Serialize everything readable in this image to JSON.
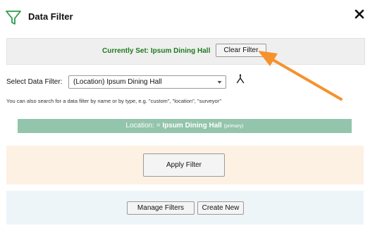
{
  "header": {
    "title": "Data Filter",
    "icon": "funnel-icon",
    "close_icon": "close-icon"
  },
  "current": {
    "label": "Currently Set: Ipsum Dining Hall",
    "clear_button": "Clear Filter"
  },
  "select": {
    "label": "Select Data Filter:",
    "value": "(Location) Ipsum Dining Hall",
    "hint": "You can also search for a data filter by name or by type, e.g. \"custom\", \"location\", \"surveyor\""
  },
  "location_bar": {
    "prefix": "Location: = ",
    "name": "Ipsum Dining Hall",
    "suffix": "(primary)"
  },
  "apply": {
    "button": "Apply Filter"
  },
  "manage": {
    "manage_button": "Manage Filters",
    "create_button": "Create New"
  },
  "colors": {
    "accent_green": "#1f7a1f",
    "location_bar": "#93c4ac",
    "apply_panel": "#fdf1e3",
    "manage_panel": "#eef5f8",
    "annotation_arrow": "#f5922e"
  }
}
